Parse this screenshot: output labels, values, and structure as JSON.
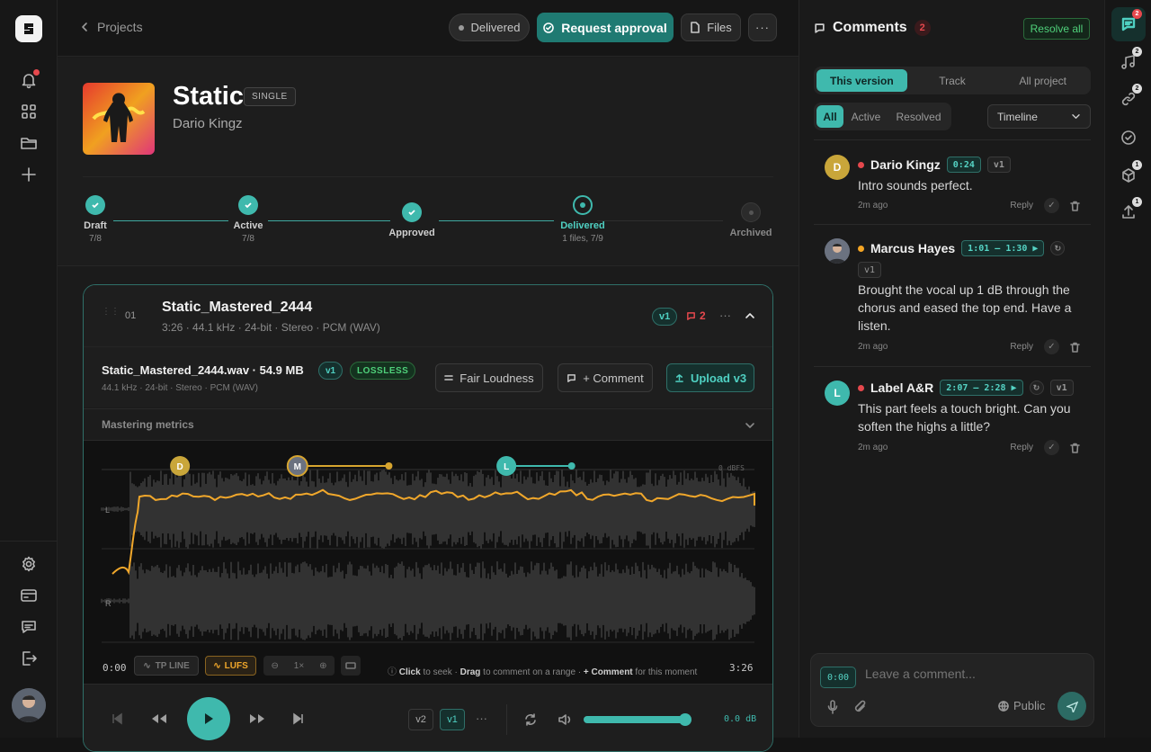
{
  "nav": {
    "back_label": "Projects"
  },
  "top_actions": {
    "status_label": "Delivered",
    "request_label": "Request approval",
    "files_label": "Files"
  },
  "release": {
    "title": "Static",
    "kind": "SINGLE",
    "artist": "Dario Kingz"
  },
  "steps": [
    {
      "label": "Draft",
      "sub": "7/8",
      "state": "done"
    },
    {
      "label": "Active",
      "sub": "7/8",
      "state": "done"
    },
    {
      "label": "Approved",
      "sub": "",
      "state": "done"
    },
    {
      "label": "Delivered",
      "sub": "1 files, 7/9",
      "state": "current"
    },
    {
      "label": "Archived",
      "sub": "",
      "state": "pending"
    }
  ],
  "track": {
    "number": "01",
    "name": "Static_Mastered_2444",
    "meta": "3:26 · 44.1 kHz · 24-bit · Stereo · PCM (WAV)",
    "version": "v1",
    "comment_count": "2",
    "file_name": "Static_Mastered_2444.wav · 54.9 MB",
    "file_version": "v1",
    "file_badge": "LOSSLESS",
    "file_meta": "44.1 kHz · 24-bit · Stereo · PCM (WAV)",
    "fair_loudness_label": "Fair Loudness",
    "comment_label": "+ Comment",
    "upload_label": "Upload v3",
    "metrics_label": "Mastering metrics",
    "dbfs_label": "0 dBFS",
    "ch_left": "L",
    "ch_right": "R",
    "time_start": "0:00",
    "time_end": "3:26",
    "tp_line_label": "TP LINE",
    "lufs_label": "LUFS",
    "zoom_label": "1×",
    "hint": {
      "click": "Click",
      "seek": " to seek · ",
      "drag": "Drag",
      "range": " to comment on a range · ",
      "comment": "+ Comment",
      "moment": " for this moment"
    },
    "markers": [
      {
        "initial": "D",
        "start": 0.12,
        "end": null,
        "color": "#c9a63a"
      },
      {
        "initial": "M",
        "start": 0.3,
        "end": 0.44,
        "color": "#d7a52f"
      },
      {
        "initial": "L",
        "start": 0.62,
        "end": 0.72,
        "color": "#3fb9ad"
      }
    ]
  },
  "player": {
    "v2_label": "v2",
    "v1_label": "v1",
    "gain_label": "0.0 dB",
    "volume": 0.94
  },
  "comments_panel": {
    "title": "Comments",
    "count": "2",
    "resolve_all_label": "Resolve all",
    "scope_tabs": [
      "This version",
      "Track",
      "All project"
    ],
    "filter_tabs": [
      "All",
      "Active",
      "Resolved"
    ],
    "sort_label": "Timeline",
    "reply_label": "Reply",
    "items": [
      {
        "initial": "D",
        "author": "Dario Kingz",
        "status_color": "#e5484d",
        "time": "0:24",
        "version": "v1",
        "text": "Intro sounds perfect.",
        "ago": "2m ago"
      },
      {
        "initial": "M",
        "author": "Marcus Hayes",
        "status_color": "#f5a524",
        "time": "1:01 — 1:30 ▶",
        "version": "v1",
        "text": "Brought the vocal up 1 dB through the chorus and eased the top end. Have a listen.",
        "ago": "2m ago"
      },
      {
        "initial": "L",
        "author": "Label A&R",
        "status_color": "#e5484d",
        "time": "2:07 — 2:28 ▶",
        "version": "v1",
        "text": "This part feels a touch bright. Can you soften the highs a little?",
        "ago": "2m ago"
      }
    ],
    "composer": {
      "time": "0:00",
      "placeholder": "Leave a comment...",
      "visibility": "Public"
    }
  },
  "right_rail_badges": {
    "comments": "2",
    "music": "2",
    "links": "2",
    "package": "1",
    "upload": "1"
  },
  "colors": {
    "accent": "#3fb9ad",
    "accent_dark": "#1f7a72",
    "lufs": "#f0a72b",
    "alert": "#e5484d"
  }
}
